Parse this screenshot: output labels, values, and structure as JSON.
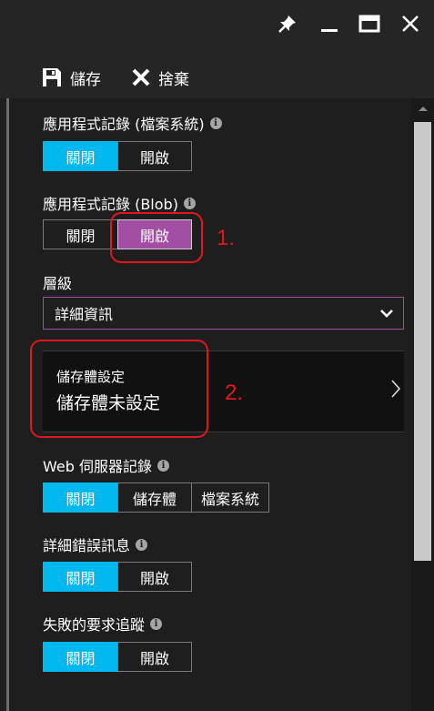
{
  "titlebar": {
    "pin_icon": "pin-icon",
    "minimize_icon": "minimize-icon",
    "maximize_icon": "maximize-icon",
    "close_icon": "close-icon"
  },
  "commands": {
    "save_label": "儲存",
    "discard_label": "捨棄"
  },
  "app_log_fs": {
    "label": "應用程式記錄 (檔案系統)",
    "options": [
      "關閉",
      "開啟"
    ],
    "selected": "關閉"
  },
  "app_log_blob": {
    "label": "應用程式記錄 (Blob)",
    "options": [
      "關閉",
      "開啟"
    ],
    "selected": "開啟"
  },
  "level": {
    "label": "層級",
    "value": "詳細資訊"
  },
  "storage": {
    "caption": "儲存體設定",
    "value": "儲存體未設定"
  },
  "web_server_log": {
    "label": "Web 伺服器記錄",
    "options": [
      "關閉",
      "儲存體",
      "檔案系統"
    ],
    "selected": "關閉"
  },
  "detailed_errors": {
    "label": "詳細錯誤訊息",
    "options": [
      "關閉",
      "開啟"
    ],
    "selected": "關閉"
  },
  "failed_request_tracing": {
    "label": "失敗的要求追蹤",
    "options": [
      "關閉",
      "開啟"
    ],
    "selected": "關閉"
  },
  "annotations": {
    "first": "1.",
    "second": "2."
  },
  "colors": {
    "accent": "#00b7ee",
    "purple": "#a24ea4",
    "annotation": "#e2161d"
  }
}
